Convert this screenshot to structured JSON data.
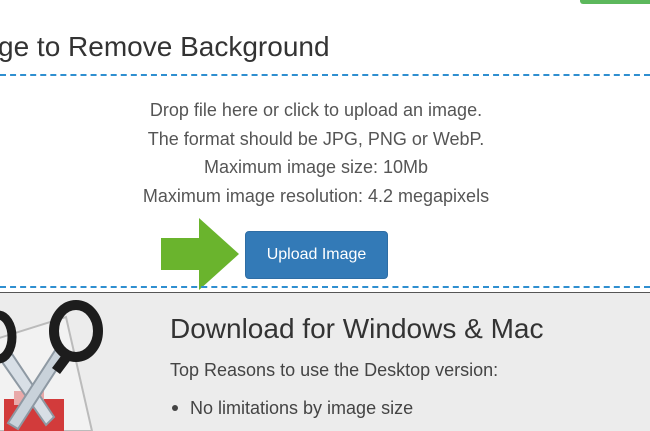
{
  "upload": {
    "title": "ge to Remove Background",
    "instructions": [
      "Drop file here or click to upload an image.",
      "The format should be JPG, PNG or WebP.",
      "Maximum image size: 10Mb",
      "Maximum image resolution: 4.2 megapixels"
    ],
    "button_label": "Upload Image"
  },
  "desktop": {
    "title": "Download for Windows & Mac",
    "subtitle": "Top Reasons to use the Desktop version:",
    "reasons": [
      "No limitations by image size"
    ]
  },
  "icons": {
    "arrow": "green-arrow-right-icon",
    "logo": "scissors-logo-icon"
  },
  "colors": {
    "accent_dash": "#2f8fd0",
    "button": "#337ab7",
    "arrow": "#6ab42d",
    "desktop_bg": "#ececec"
  }
}
